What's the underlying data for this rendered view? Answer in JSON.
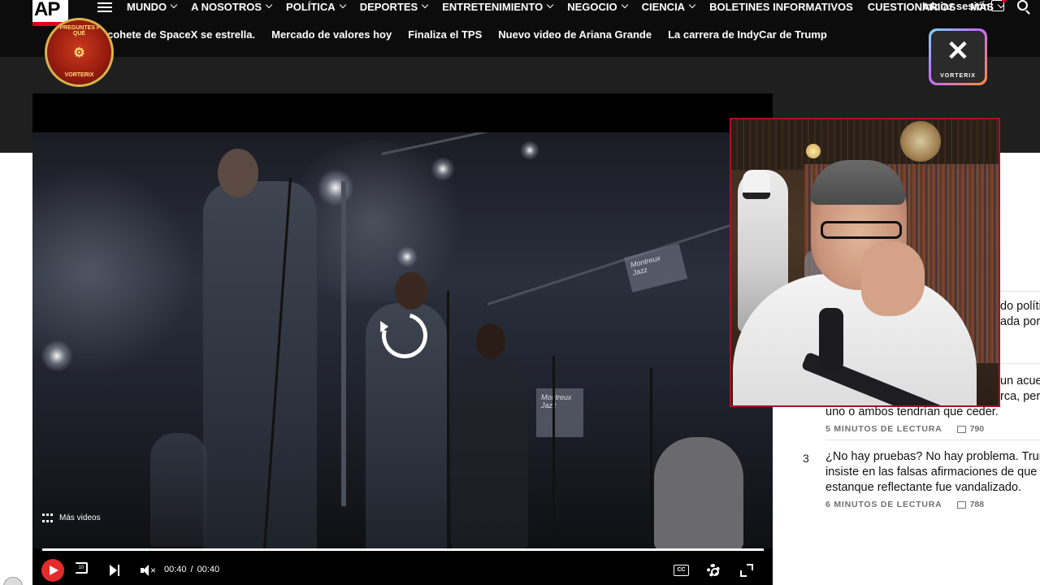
{
  "site": {
    "logo_text": "AP",
    "nav": [
      {
        "label": "MUNDO",
        "has_menu": true
      },
      {
        "label": "A NOSOTROS",
        "has_menu": true
      },
      {
        "label": "POLÍTICA",
        "has_menu": true
      },
      {
        "label": "DEPORTES",
        "has_menu": true
      },
      {
        "label": "ENTRETENIMIENTO",
        "has_menu": true
      },
      {
        "label": "NEGOCIO",
        "has_menu": true
      },
      {
        "label": "CIENCIA",
        "has_menu": true
      },
      {
        "label": "BOLETINES INFORMATIVOS",
        "has_menu": false
      },
      {
        "label": "CUESTIONARIOS",
        "has_menu": false
      },
      {
        "label": "MÁS",
        "has_menu": true
      }
    ],
    "signin_label": "Iniciar sesión",
    "trending": [
      "cohete de SpaceX se estrella.",
      "Mercado de valores hoy",
      "Finaliza el TPS",
      "Nuevo video de Ariana Grande",
      "La carrera de IndyCar de Trump"
    ]
  },
  "overlay": {
    "left_badge": {
      "top": "NO PREGUNTES POR QUÉ",
      "bottom": "VORTERIX"
    },
    "right_logo": {
      "mark": "✕",
      "text": "VORTERIX"
    }
  },
  "video": {
    "more_videos_label": "Más videos",
    "current_time": "00:40",
    "separator": "/",
    "duration": "00:40",
    "progress": 1.0,
    "rewind_label": "10",
    "cc_label": "CC",
    "stage_sign_1": "Montreux Jazz",
    "stage_sign_2": "Montreux Jazz"
  },
  "articles": [
    {
      "rank": "",
      "peek_lines": [
        "do polític",
        "ada por e"
      ]
    },
    {
      "rank": "",
      "peek_lines": [
        "un acuer",
        "rca, pero"
      ],
      "last_line": "uno o ambos tendrían que ceder.",
      "read_time": "5 MINUTOS DE LECTURA",
      "comments": "790"
    },
    {
      "rank": "3",
      "lines": [
        "¿No hay pruebas? No hay problema. Trump",
        "insiste en las falsas afirmaciones de que el",
        "estanque reflectante fue vandalizado."
      ],
      "read_time": "6 MINUTOS DE LECTURA",
      "comments": "788"
    }
  ],
  "colors": {
    "accent_red": "#e3001b",
    "play_red": "#e32b2b",
    "topbar": "#0c0c0c"
  }
}
